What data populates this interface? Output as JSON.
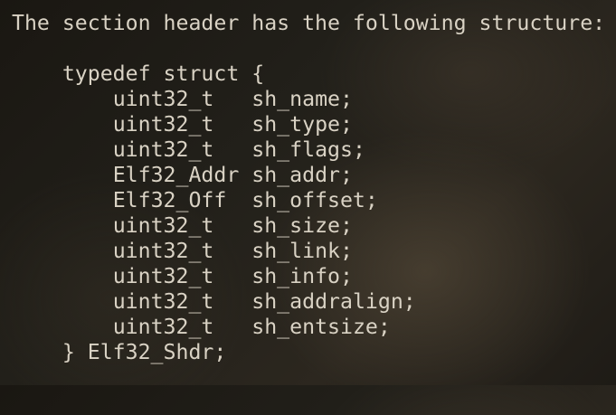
{
  "intro": "The section header has the following structure:",
  "struct_open": "    typedef struct {",
  "fields": [
    {
      "type": "uint32_t",
      "name": "sh_name;"
    },
    {
      "type": "uint32_t",
      "name": "sh_type;"
    },
    {
      "type": "uint32_t",
      "name": "sh_flags;"
    },
    {
      "type": "Elf32_Addr",
      "name": "sh_addr;"
    },
    {
      "type": "Elf32_Off",
      "name": "sh_offset;"
    },
    {
      "type": "uint32_t",
      "name": "sh_size;"
    },
    {
      "type": "uint32_t",
      "name": "sh_link;"
    },
    {
      "type": "uint32_t",
      "name": "sh_info;"
    },
    {
      "type": "uint32_t",
      "name": "sh_addralign;"
    },
    {
      "type": "uint32_t",
      "name": "sh_entsize;"
    }
  ],
  "struct_close": "    } Elf32_Shdr;"
}
